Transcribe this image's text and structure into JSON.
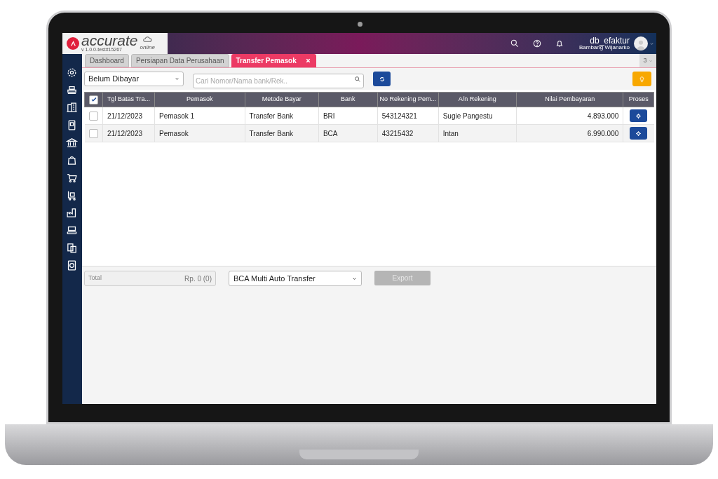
{
  "header": {
    "logo_text": "accurate",
    "logo_subtext": "online",
    "version": "v 1.0.0-test#15267",
    "database": "db_efaktur",
    "user": "Bambang Wijanarko"
  },
  "tabs": [
    {
      "label": "Dashboard",
      "selected": false
    },
    {
      "label": "Persiapan Data Perusahaan",
      "selected": false
    },
    {
      "label": "Transfer Pemasok",
      "selected": true
    }
  ],
  "tab_count": "3",
  "toolbar": {
    "status_filter": "Belum Dibayar",
    "search": {
      "placeholder": "Cari Nomor/Nama bank/Rek.."
    }
  },
  "table": {
    "select_all_checked": true,
    "columns": [
      "Tgl Batas Tra...",
      "Pemasok",
      "Metode Bayar",
      "Bank",
      "No Rekening Pem...",
      "A/n Rekening",
      "Nilai Pembayaran",
      "Proses"
    ],
    "rows": [
      {
        "checked": false,
        "cells": [
          "21/12/2023",
          "Pemasok 1",
          "Transfer Bank",
          "BRI",
          "543124321",
          "Sugie Pangestu",
          "4.893.000"
        ]
      },
      {
        "checked": false,
        "cells": [
          "21/12/2023",
          "Pemasok",
          "Transfer Bank",
          "BCA",
          "43215432",
          "Intan",
          "6.990.000"
        ]
      }
    ]
  },
  "footer": {
    "total_label": "Total",
    "total_value": "Rp. 0 (0)",
    "export_format": "BCA Multi Auto Transfer",
    "export_button": {
      "label": "Export",
      "disabled": true
    }
  }
}
